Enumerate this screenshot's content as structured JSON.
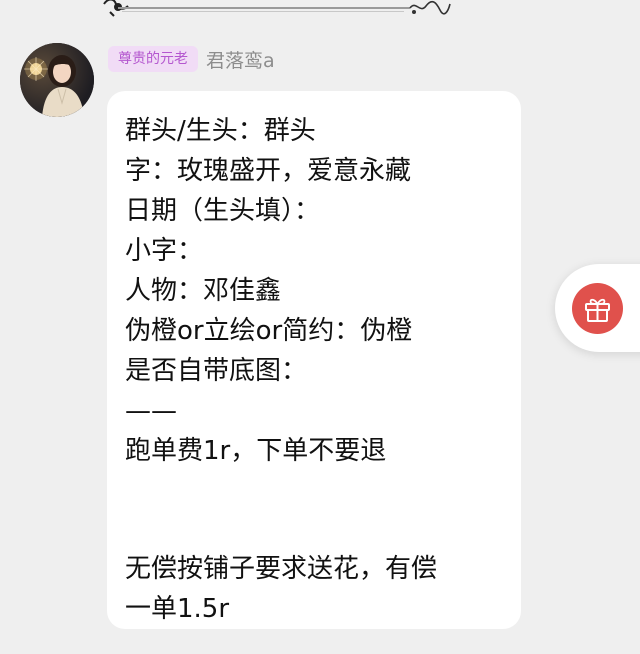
{
  "chat": {
    "sender": {
      "badge": "尊贵的元老",
      "name": "君落鸾a"
    },
    "message": {
      "lines": [
        "群头/生头：群头",
        "字：玫瑰盛开，爱意永藏",
        "日期（生头填）：",
        "小字：",
        "人物：邓佳鑫",
        "伪橙or立绘or简约：伪橙",
        "是否自带底图：",
        "——",
        "跑单费1r，下单不要退",
        "",
        "",
        "无偿按铺子要求送花，有偿",
        "一单1.5r"
      ]
    }
  },
  "icons": {
    "gift": "gift-icon",
    "avatar": "user-avatar"
  },
  "colors": {
    "badge_bg": "#f1dcf6",
    "badge_text": "#b457cf",
    "gift_button": "#e0514c",
    "bubble": "#ffffff",
    "background": "#efefef"
  }
}
